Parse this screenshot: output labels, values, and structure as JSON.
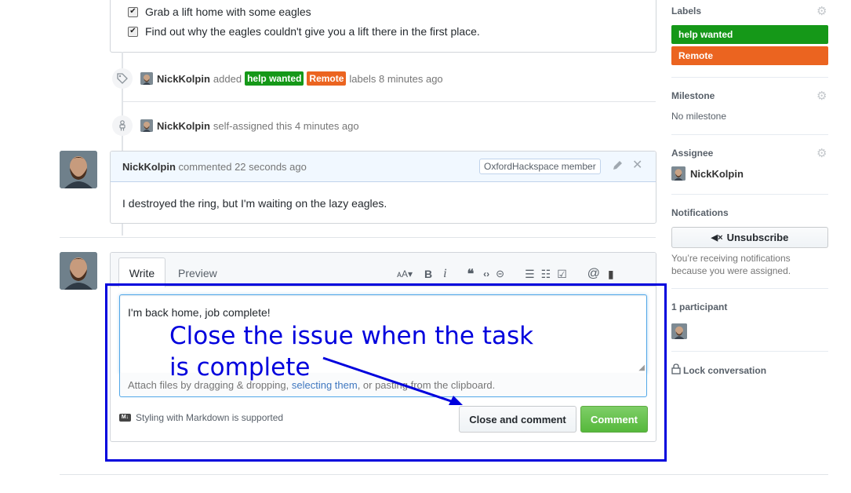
{
  "checklist": [
    {
      "label": "Grab a lift home with some eagles",
      "checked": true
    },
    {
      "label": "Find out why the eagles couldn't give you a lift there in the first place.",
      "checked": true
    }
  ],
  "events": {
    "labels_event": {
      "user": "NickKolpin",
      "action": "added",
      "label1": "help wanted",
      "label2": "Remote",
      "suffix": "labels 8 minutes ago"
    },
    "assign_event": {
      "user": "NickKolpin",
      "text": "self-assigned this 4 minutes ago"
    }
  },
  "comment": {
    "author": "NickKolpin",
    "meta": "commented 22 seconds ago",
    "badge": "OxfordHackspace member",
    "body": "I destroyed the ring, but I'm waiting on the lazy eagles."
  },
  "editor": {
    "tab_write": "Write",
    "tab_preview": "Preview",
    "text": "I'm back home, job complete!",
    "attach_pre": "Attach files by dragging & dropping, ",
    "attach_link": "selecting them",
    "attach_post": ", or pasting from the clipboard.",
    "markdown_note": "Styling with Markdown is supported",
    "close_label": "Close and comment",
    "comment_label": "Comment"
  },
  "annotation": {
    "line1": "Close the issue when the task",
    "line2": "is complete",
    "color": "#0000dd"
  },
  "sidebar": {
    "labels_title": "Labels",
    "labels": [
      {
        "name": "help wanted",
        "color": "#159818"
      },
      {
        "name": "Remote",
        "color": "#eb6420"
      }
    ],
    "milestone_title": "Milestone",
    "milestone_value": "No milestone",
    "assignee_title": "Assignee",
    "assignee_name": "NickKolpin",
    "notifications_title": "Notifications",
    "unsubscribe_label": "Unsubscribe",
    "notif_text": "You’re receiving notifications because you were assigned.",
    "participants_title": "1 participant",
    "lock_label": "Lock conversation"
  }
}
